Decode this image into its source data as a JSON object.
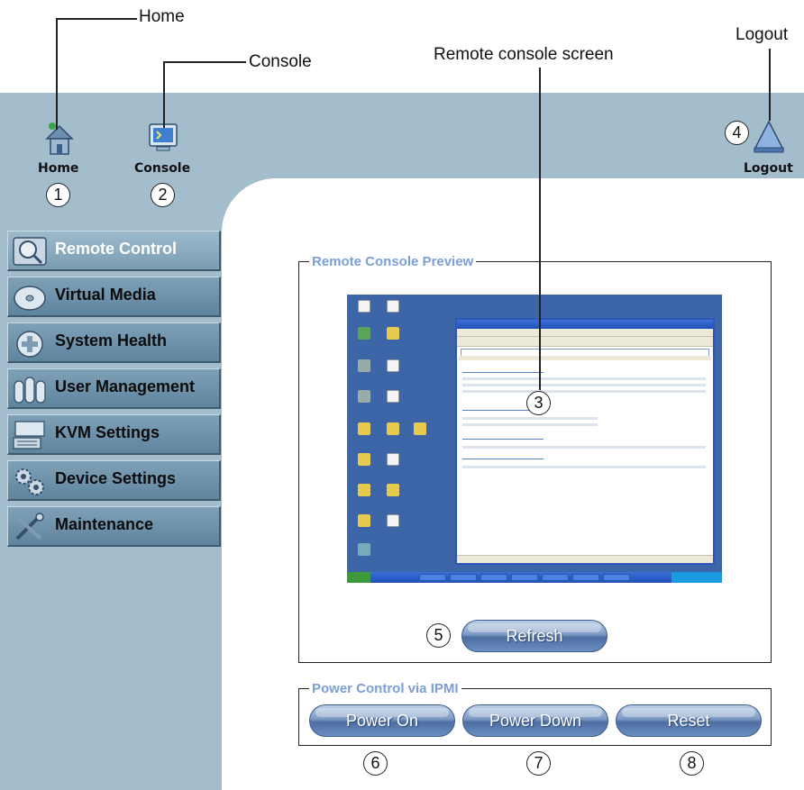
{
  "callouts": {
    "home": "Home",
    "console": "Console",
    "remote_screen": "Remote console screen",
    "logout": "Logout"
  },
  "numbers": [
    "1",
    "2",
    "3",
    "4",
    "5",
    "6",
    "7",
    "8"
  ],
  "toolbar": {
    "home_label": "Home",
    "console_label": "Console",
    "logout_label": "Logout"
  },
  "sidebar": {
    "items": [
      {
        "label": "Remote Control",
        "icon": "magnifier-icon",
        "active": true
      },
      {
        "label": "Virtual Media",
        "icon": "disc-icon"
      },
      {
        "label": "System Health",
        "icon": "health-cross-icon"
      },
      {
        "label": "User Management",
        "icon": "users-icon"
      },
      {
        "label": "KVM Settings",
        "icon": "keyboard-monitor-icon"
      },
      {
        "label": "Device Settings",
        "icon": "gears-icon"
      },
      {
        "label": "Maintenance",
        "icon": "tools-icon"
      }
    ]
  },
  "preview": {
    "title": "Remote Console Preview",
    "refresh_label": "Refresh"
  },
  "power": {
    "title": "Power Control via IPMI",
    "power_on_label": "Power On",
    "power_down_label": "Power Down",
    "reset_label": "Reset"
  },
  "colors": {
    "frame": "#a3bdcc",
    "nav": "#6f93ab",
    "group_title": "#7b9fd6",
    "button": "#6b8ec0"
  }
}
